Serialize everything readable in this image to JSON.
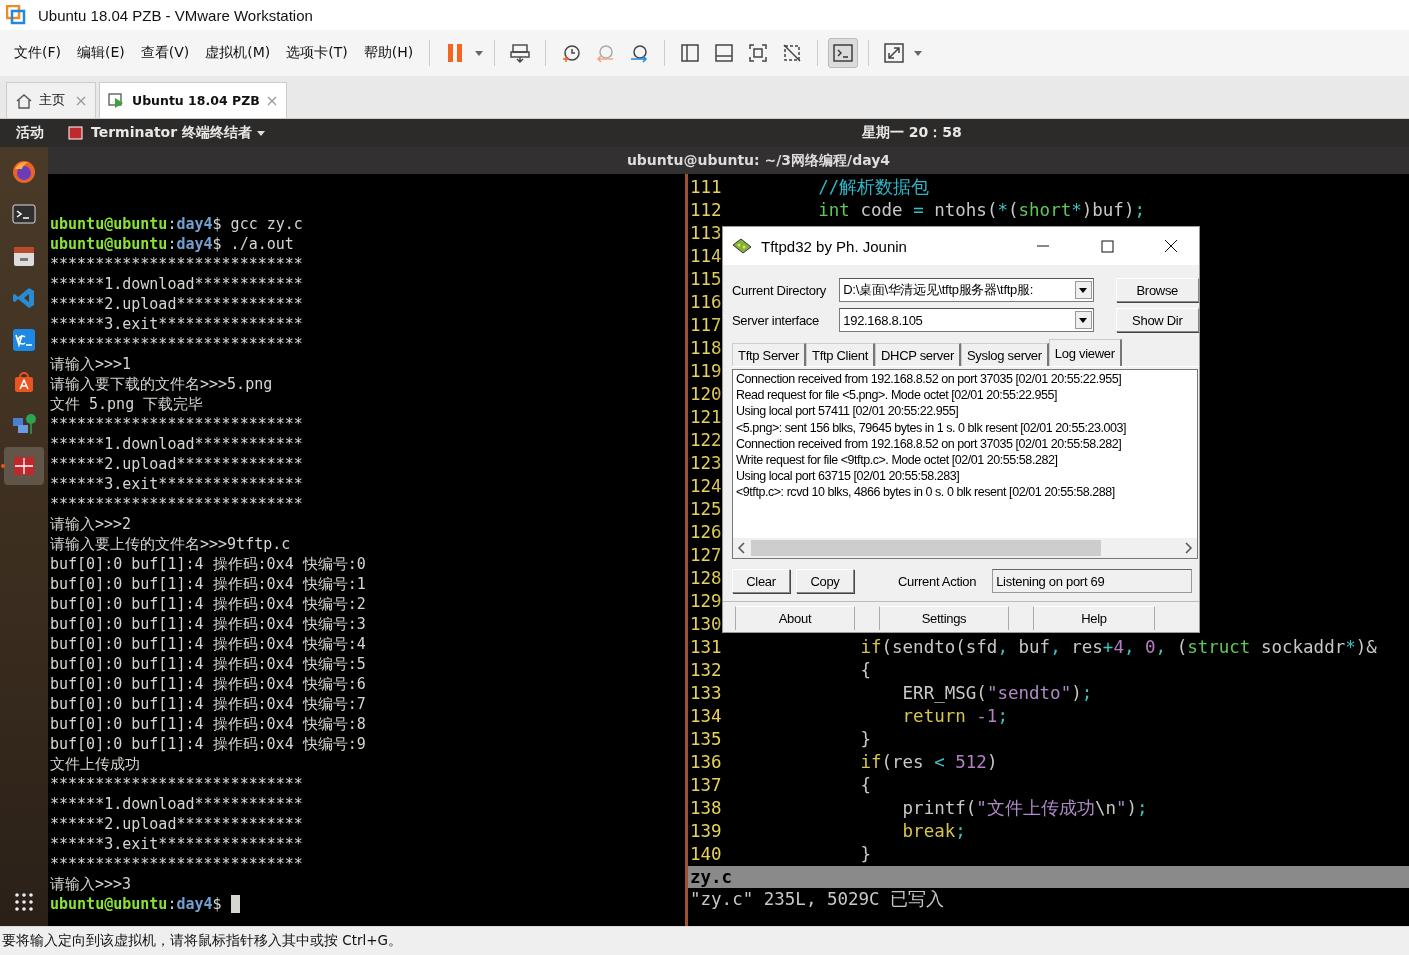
{
  "window": {
    "title": "Ubuntu 18.04 PZB - VMware Workstation"
  },
  "menu": [
    "文件(F)",
    "编辑(E)",
    "查看(V)",
    "虚拟机(M)",
    "选项卡(T)",
    "帮助(H)"
  ],
  "tabs": [
    {
      "label": "主页",
      "selected": false
    },
    {
      "label": "Ubuntu 18.04 PZB",
      "selected": true
    }
  ],
  "gnome_bar": {
    "activities": "活动",
    "app": "Terminator 终端终结者",
    "clock": "星期一 20：58"
  },
  "dock": {
    "items": [
      {
        "kind": "firefox",
        "selected": false
      },
      {
        "kind": "terminal",
        "selected": false
      },
      {
        "kind": "files",
        "selected": false
      },
      {
        "kind": "code",
        "selected": false
      },
      {
        "kind": "vnc",
        "selected": false
      },
      {
        "kind": "store",
        "selected": false
      },
      {
        "kind": "network",
        "selected": false
      },
      {
        "kind": "terminator",
        "selected": true
      }
    ]
  },
  "terminal": {
    "title": "ubuntu@ubuntu: ~/3网络编程/day4",
    "left_pane": {
      "lines": [
        {
          "kind": "prompt",
          "user": "ubuntu@ubuntu",
          "separator": ":",
          "path": "day4",
          "sign": "$",
          "command": "gcc zy.c",
          "cursor": false
        },
        {
          "kind": "prompt",
          "user": "ubuntu@ubuntu",
          "separator": ":",
          "path": "day4",
          "sign": "$",
          "command": "./a.out",
          "cursor": false
        },
        {
          "kind": "output",
          "text": "****************************"
        },
        {
          "kind": "output",
          "text": "******1.download************"
        },
        {
          "kind": "output",
          "text": "******2.upload**************"
        },
        {
          "kind": "output",
          "text": "******3.exit****************"
        },
        {
          "kind": "output",
          "text": "****************************"
        },
        {
          "kind": "output",
          "text": "请输入>>>1"
        },
        {
          "kind": "output",
          "text": "请输入要下载的文件名>>>5.png"
        },
        {
          "kind": "output",
          "text": "文件 5.png 下载完毕"
        },
        {
          "kind": "output",
          "text": "****************************"
        },
        {
          "kind": "output",
          "text": "******1.download************"
        },
        {
          "kind": "output",
          "text": "******2.upload**************"
        },
        {
          "kind": "output",
          "text": "******3.exit****************"
        },
        {
          "kind": "output",
          "text": "****************************"
        },
        {
          "kind": "output",
          "text": "请输入>>>2"
        },
        {
          "kind": "output",
          "text": "请输入要上传的文件名>>>9tftp.c"
        },
        {
          "kind": "output",
          "text": "buf[0]:0 buf[1]:4 操作码:0x4 快编号:0"
        },
        {
          "kind": "output",
          "text": "buf[0]:0 buf[1]:4 操作码:0x4 快编号:1"
        },
        {
          "kind": "output",
          "text": "buf[0]:0 buf[1]:4 操作码:0x4 快编号:2"
        },
        {
          "kind": "output",
          "text": "buf[0]:0 buf[1]:4 操作码:0x4 快编号:3"
        },
        {
          "kind": "output",
          "text": "buf[0]:0 buf[1]:4 操作码:0x4 快编号:4"
        },
        {
          "kind": "output",
          "text": "buf[0]:0 buf[1]:4 操作码:0x4 快编号:5"
        },
        {
          "kind": "output",
          "text": "buf[0]:0 buf[1]:4 操作码:0x4 快编号:6"
        },
        {
          "kind": "output",
          "text": "buf[0]:0 buf[1]:4 操作码:0x4 快编号:7"
        },
        {
          "kind": "output",
          "text": "buf[0]:0 buf[1]:4 操作码:0x4 快编号:8"
        },
        {
          "kind": "output",
          "text": "buf[0]:0 buf[1]:4 操作码:0x4 快编号:9"
        },
        {
          "kind": "output",
          "text": "文件上传成功"
        },
        {
          "kind": "output",
          "text": "****************************"
        },
        {
          "kind": "output",
          "text": "******1.download************"
        },
        {
          "kind": "output",
          "text": "******2.upload**************"
        },
        {
          "kind": "output",
          "text": "******3.exit****************"
        },
        {
          "kind": "output",
          "text": "****************************"
        },
        {
          "kind": "output",
          "text": "请输入>>>3"
        },
        {
          "kind": "prompt",
          "user": "ubuntu@ubuntu",
          "separator": ":",
          "path": "day4",
          "sign": "$",
          "cursor": true
        }
      ]
    },
    "editor": {
      "lines": [
        {
          "number": "111",
          "tokens": [
            {
              "kind": "comment",
              "text": "        //解析数据包"
            }
          ]
        },
        {
          "number": "112",
          "tokens": [
            {
              "kind": "type",
              "text": "        int"
            },
            {
              "kind": "plain",
              "text": " code "
            },
            {
              "kind": "op",
              "text": "="
            },
            {
              "kind": "plain",
              "text": " ntohs("
            },
            {
              "kind": "op",
              "text": "*"
            },
            {
              "kind": "plain",
              "text": "("
            },
            {
              "kind": "type",
              "text": "short"
            },
            {
              "kind": "op",
              "text": "*"
            },
            {
              "kind": "plain",
              "text": ")buf)"
            },
            {
              "kind": "op",
              "text": ";"
            }
          ]
        },
        {
          "number": "113"
        },
        {
          "number": "114"
        },
        {
          "number": "115"
        },
        {
          "number": "116"
        },
        {
          "number": "117"
        },
        {
          "number": "118"
        },
        {
          "number": "119"
        },
        {
          "number": "120"
        },
        {
          "number": "121"
        },
        {
          "number": "122"
        },
        {
          "number": "123"
        },
        {
          "number": "124"
        },
        {
          "number": "125"
        },
        {
          "number": "126"
        },
        {
          "number": "127"
        },
        {
          "number": "128"
        },
        {
          "number": "129"
        },
        {
          "number": "130"
        },
        {
          "number": "131",
          "tokens": [
            {
              "kind": "keyword",
              "text": "            if"
            },
            {
              "kind": "plain",
              "text": "(sendto(sfd"
            },
            {
              "kind": "op",
              "text": ","
            },
            {
              "kind": "plain",
              "text": " buf"
            },
            {
              "kind": "op",
              "text": ","
            },
            {
              "kind": "plain",
              "text": " res"
            },
            {
              "kind": "op",
              "text": "+"
            },
            {
              "kind": "number",
              "text": "4"
            },
            {
              "kind": "op",
              "text": ","
            },
            {
              "kind": "number",
              "text": " 0"
            },
            {
              "kind": "op",
              "text": ","
            },
            {
              "kind": "plain",
              "text": " ("
            },
            {
              "kind": "type",
              "text": "struct"
            },
            {
              "kind": "plain",
              "text": " sockaddr"
            },
            {
              "kind": "op",
              "text": "*"
            },
            {
              "kind": "plain",
              "text": ")&"
            }
          ]
        },
        {
          "number": "132",
          "tokens": [
            {
              "kind": "plain",
              "text": "            {"
            }
          ]
        },
        {
          "number": "133",
          "tokens": [
            {
              "kind": "plain",
              "text": "                ERR_MSG("
            },
            {
              "kind": "string",
              "text": "\"sendto\""
            },
            {
              "kind": "plain",
              "text": ")"
            },
            {
              "kind": "op",
              "text": ";"
            }
          ]
        },
        {
          "number": "134",
          "tokens": [
            {
              "kind": "keyword",
              "text": "                return"
            },
            {
              "kind": "number",
              "text": " -1"
            },
            {
              "kind": "op",
              "text": ";"
            }
          ]
        },
        {
          "number": "135",
          "tokens": [
            {
              "kind": "plain",
              "text": "            }"
            }
          ]
        },
        {
          "number": "136",
          "tokens": [
            {
              "kind": "keyword",
              "text": "            if"
            },
            {
              "kind": "plain",
              "text": "(res "
            },
            {
              "kind": "op",
              "text": "<"
            },
            {
              "kind": "number",
              "text": " 512"
            },
            {
              "kind": "plain",
              "text": ")"
            }
          ]
        },
        {
          "number": "137",
          "tokens": [
            {
              "kind": "plain",
              "text": "            {"
            }
          ]
        },
        {
          "number": "138",
          "tokens": [
            {
              "kind": "plain",
              "text": "                printf("
            },
            {
              "kind": "string",
              "text": "\"文件上传成功"
            },
            {
              "kind": "plain",
              "text": "\\n"
            },
            {
              "kind": "string",
              "text": "\""
            },
            {
              "kind": "plain",
              "text": ")"
            },
            {
              "kind": "op",
              "text": ";"
            }
          ]
        },
        {
          "number": "139",
          "tokens": [
            {
              "kind": "keyword",
              "text": "                break"
            },
            {
              "kind": "op",
              "text": ";"
            }
          ]
        },
        {
          "number": "140",
          "tokens": [
            {
              "kind": "plain",
              "text": "            }"
            }
          ]
        }
      ],
      "file_status": "zy.c",
      "message": "\"zy.c\" 235L, 5029C 已写入"
    }
  },
  "dialog": {
    "title": "Tftpd32 by Ph. Jounin",
    "directory": {
      "label": "Current Directory",
      "value": "D:\\桌面\\华清远见\\tftp服务器\\tftp服:"
    },
    "interface": {
      "label": "Server interface",
      "value": "192.168.8.105"
    },
    "side_buttons": [
      "Browse",
      "Show Dir"
    ],
    "tabs": [
      {
        "label": "Tftp Server",
        "selected": false
      },
      {
        "label": "Tftp Client",
        "selected": false
      },
      {
        "label": "DHCP server",
        "selected": false
      },
      {
        "label": "Syslog server",
        "selected": false
      },
      {
        "label": "Log viewer",
        "selected": true
      }
    ],
    "log": [
      "Connection received from 192.168.8.52 on port 37035 [02/01 20:55:22.955]",
      "Read request for file <5.png>. Mode octet [02/01 20:55:22.955]",
      "Using local port 57411 [02/01 20:55:22.955]",
      "<5.png>: sent 156 blks, 79645 bytes in 1 s. 0 blk resent [02/01 20:55:23.003]",
      "Connection received from 192.168.8.52 on port 37035 [02/01 20:55:58.282]",
      "Write request for file <9tftp.c>. Mode octet [02/01 20:55:58.282]",
      "Using local port 63715 [02/01 20:55:58.283]",
      "<9tftp.c>: rcvd 10 blks, 4866 bytes in 0 s. 0 blk resent [02/01 20:55:58.288]"
    ],
    "action_buttons": [
      "Clear",
      "Copy"
    ],
    "current_action": {
      "label": "Current Action",
      "value": "Listening on port 69"
    },
    "bottom_buttons": [
      "About",
      "Settings",
      "Help"
    ]
  },
  "status_bar": "要将输入定向到该虚拟机，请将鼠标指针移入其中或按 Ctrl+G。"
}
